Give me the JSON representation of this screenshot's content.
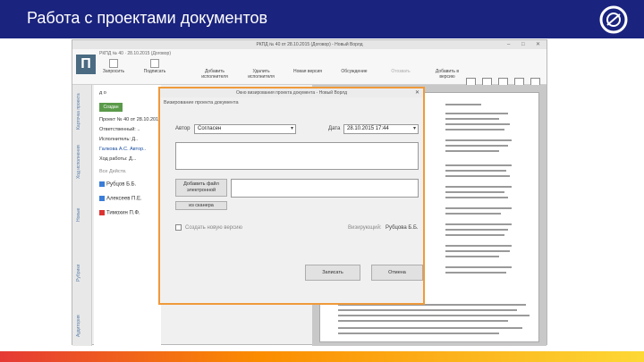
{
  "slide": {
    "title": "Работа с проектами документов",
    "colors": {
      "header": "#1a237e",
      "accent": "#ef9a3a"
    }
  },
  "window": {
    "title": "РКПД № 40 от 28.10.2015 (Договор) - Новый Ворлд"
  },
  "ribbon": {
    "doc_title": "РКПД № 40 · 28.10.2015 (Договор)",
    "buttons": [
      "Запросить",
      "Подписать",
      "Добавить исполнителя",
      "Удалить исполнителя",
      "Новая версия",
      "Обсуждение",
      "Отозвать",
      "Добавить в версию"
    ]
  },
  "left_rail": {
    "tabs": [
      "Карточка проекта",
      "Ход исполнения",
      "Новые",
      "Рубрики",
      "Аудитория"
    ]
  },
  "panel": {
    "doc_label": "д о",
    "saved_badge": "Создан",
    "lines": [
      "Проект № 40 от 28.10.2015",
      "Ответственный: ..",
      "Исполнитель: Д..",
      "Галкова А.С. Автор..",
      "Ход работы: Д..."
    ],
    "tabs_row": "Все  Действ.",
    "people": [
      {
        "name": "Рубцов Б.Б."
      },
      {
        "name": "Алексеев П.Е."
      },
      {
        "name": "Тимохин П.Ф."
      }
    ]
  },
  "dialog": {
    "title": "Окно визирования проекта документа - Новый Ворлд",
    "subtitle": "Визирование проекта документа",
    "author_label": "Автор",
    "author_value": "Согласен",
    "date_label": "Дата",
    "date_value": "28.10.2015 17:44",
    "add_file_label": "Добавить файл электронной",
    "from_scanner_label": "из сканера",
    "checkbox_label": "Создать новую версию",
    "signer_label": "Визирующий:",
    "signer_value": "Рубцова Б.Б.",
    "save_label": "Записать",
    "cancel_label": "Отмена"
  }
}
